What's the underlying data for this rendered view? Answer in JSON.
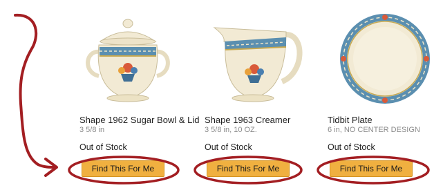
{
  "products": [
    {
      "name": "Shape 1962 Sugar Bowl & Lid",
      "spec": "3 5/8 in",
      "stock": "Out of Stock",
      "button": "Find This For Me",
      "image_icon": "sugar-bowl-image"
    },
    {
      "name": "Shape 1963 Creamer",
      "spec": "3 5/8 in, 10 OZ.",
      "stock": "Out of Stock",
      "button": "Find This For Me",
      "image_icon": "creamer-image"
    },
    {
      "name": "Tidbit Plate",
      "spec": "6 in, NO CENTER DESIGN",
      "stock": "Out of Stock",
      "button": "Find This For Me",
      "image_icon": "plate-image"
    }
  ],
  "annotation": {
    "color": "#a31e22",
    "arrow_icon": "curved-arrow-icon",
    "circle_icon": "circle-highlight-icon"
  },
  "colors": {
    "button_bg": "#f0b040",
    "china_blue": "#5b8fb0",
    "china_cream": "#f2ead4"
  }
}
